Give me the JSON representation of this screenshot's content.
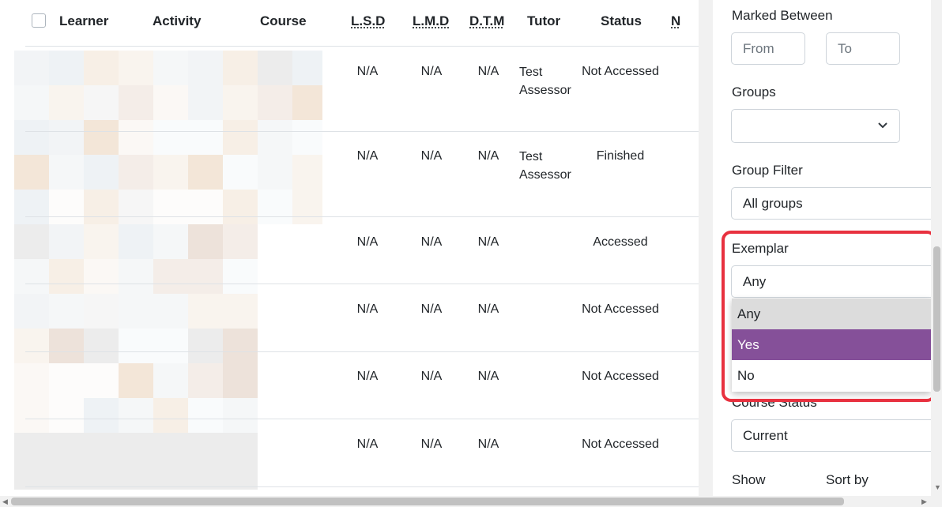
{
  "table": {
    "headers": {
      "learner": "Learner",
      "activity": "Activity",
      "course": "Course",
      "lsd": "L.S.D",
      "lmd": "L.M.D",
      "dtm": "D.T.M",
      "tutor": "Tutor",
      "status": "Status",
      "next": "N"
    },
    "rows": [
      {
        "lsd": "N/A",
        "lmd": "N/A",
        "dtm": "N/A",
        "tutor": "Test Assessor",
        "status": "Not Accessed"
      },
      {
        "lsd": "N/A",
        "lmd": "N/A",
        "dtm": "N/A",
        "tutor": "Test Assessor",
        "status": "Finished"
      },
      {
        "lsd": "N/A",
        "lmd": "N/A",
        "dtm": "N/A",
        "tutor": "",
        "status": "Accessed"
      },
      {
        "lsd": "N/A",
        "lmd": "N/A",
        "dtm": "N/A",
        "tutor": "",
        "status": "Not Accessed"
      },
      {
        "lsd": "N/A",
        "lmd": "N/A",
        "dtm": "N/A",
        "tutor": "",
        "status": "Not Accessed"
      },
      {
        "lsd": "N/A",
        "lmd": "N/A",
        "dtm": "N/A",
        "tutor": "",
        "status": "Not Accessed"
      }
    ]
  },
  "filters": {
    "marked_between": {
      "label": "Marked Between",
      "from_placeholder": "From",
      "to_placeholder": "To"
    },
    "groups": {
      "label": "Groups",
      "value": ""
    },
    "group_filter": {
      "label": "Group Filter",
      "value": "All groups"
    },
    "exemplar": {
      "label": "Exemplar",
      "value": "Any",
      "options": [
        "Any",
        "Yes",
        "No"
      ]
    },
    "course_status": {
      "label": "Course Status",
      "value": "Current"
    },
    "show": {
      "label": "Show"
    },
    "sort_by": {
      "label": "Sort by"
    }
  },
  "colors": {
    "accent_purple": "#855099",
    "highlight_red": "#e8313f"
  }
}
